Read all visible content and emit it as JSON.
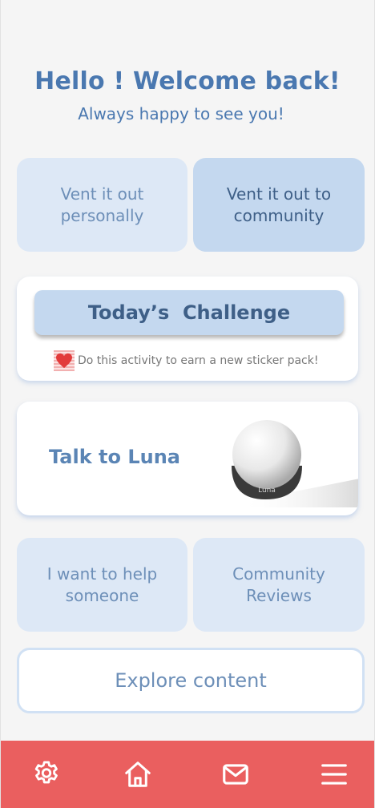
{
  "header": {
    "title": "Hello ! Welcome back!",
    "subtitle": "Always happy to see you!"
  },
  "tiles": {
    "vent_personal": "Vent it out personally",
    "vent_community": "Vent it out to community",
    "help_someone": "I want to help someone",
    "community_reviews": "Community Reviews"
  },
  "challenge": {
    "button_label": "Today’s  Challenge",
    "note": "Do this activity to earn a new sticker pack!",
    "icon": "heart-sticker-icon"
  },
  "luna": {
    "label": "Talk to Luna",
    "device_text": "Luna"
  },
  "explore": {
    "label": "Explore content"
  },
  "navbar": {
    "items": [
      "settings-icon",
      "home-icon",
      "mail-icon",
      "menu-icon"
    ]
  },
  "colors": {
    "primary_text": "#4a78b0",
    "tile_light": "#dde8f6",
    "tile_dark": "#c4d8ef",
    "navbar": "#ea5f5f"
  }
}
